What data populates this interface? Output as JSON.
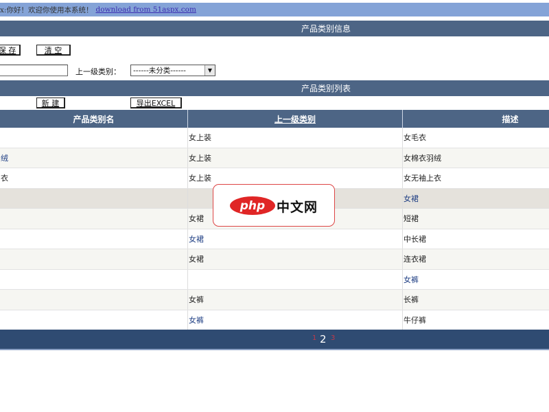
{
  "top_bar": {
    "greeting": "x:你好！欢迎你使用本系统！",
    "link": "download from 51aspx.com"
  },
  "info_section": {
    "title": "产品类别信息",
    "save_button": "保 存",
    "clear_button": "清 空",
    "parent_label": "上一级类别：",
    "parent_select_value": "------未分类------"
  },
  "list_section": {
    "title": "产品类别列表",
    "new_button": "新 建",
    "export_button": "导出EXCEL"
  },
  "table": {
    "columns": [
      "产品类别名",
      "上一级类别",
      "描述"
    ],
    "rows": [
      {
        "name": "",
        "parent": "女上装",
        "desc": "女毛衣"
      },
      {
        "name": "绒",
        "parent": "女上装",
        "desc": "女棉衣羽绒"
      },
      {
        "name": "衣",
        "parent": "女上装",
        "desc": "女无袖上衣"
      },
      {
        "name": "",
        "parent": "",
        "desc": "女裙"
      },
      {
        "name": "",
        "parent": "女裙",
        "desc": "短裙"
      },
      {
        "name": "",
        "parent": "女裙",
        "desc": "中长裙"
      },
      {
        "name": "",
        "parent": "女裙",
        "desc": "连衣裙"
      },
      {
        "name": "",
        "parent": "",
        "desc": "女裤"
      },
      {
        "name": "",
        "parent": "女裤",
        "desc": "长裤"
      },
      {
        "name": "",
        "parent": "女裤",
        "desc": "牛仔裤"
      }
    ]
  },
  "pager": {
    "prev_page": "1",
    "current_page": "2",
    "next_page": "3"
  },
  "watermark": {
    "logo": "php",
    "text": "中文网"
  },
  "colors": {
    "header_blue": "#4d6585",
    "top_bar": "#84a3d7",
    "pager_blue": "#2f4b72",
    "page_link_red": "#c0394a"
  }
}
